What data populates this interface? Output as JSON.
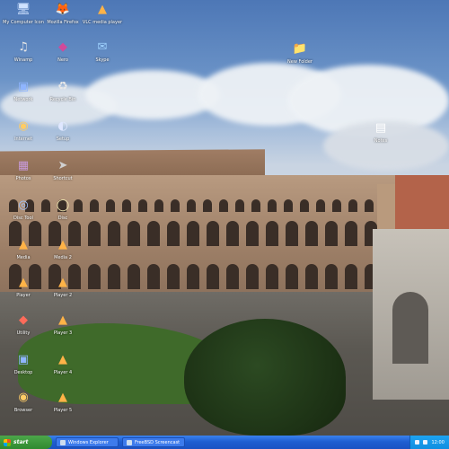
{
  "desktop": {
    "icons": [
      {
        "label": "My Computer Icon",
        "glyph": "🖥",
        "color": "#cfe2ff"
      },
      {
        "label": "Mozilla Firefox",
        "glyph": "🦊",
        "color": "#ffd9a0"
      },
      {
        "label": "VLC media player",
        "glyph": "▲",
        "color": "#ffb347"
      },
      {
        "label": "Winamp",
        "glyph": "♫",
        "color": "#e6e6e6"
      },
      {
        "label": "Nero",
        "glyph": "◆",
        "color": "#d04a9a"
      },
      {
        "label": "Skype",
        "glyph": "✉",
        "color": "#9fd3ff"
      },
      {
        "label": "New Folder",
        "glyph": "📁",
        "color": "#ffe37a"
      },
      {
        "label": "Network",
        "glyph": "▣",
        "color": "#8fb5ff"
      },
      {
        "label": "Recycle Bin",
        "glyph": "♻",
        "color": "#e8e8e8"
      },
      {
        "label": "Internet",
        "glyph": "◉",
        "color": "#ffcc66"
      },
      {
        "label": "Setup",
        "glyph": "◐",
        "color": "#dfe7ff"
      },
      {
        "label": "Notes",
        "glyph": "▤",
        "color": "#ffffff"
      },
      {
        "label": "Photos",
        "glyph": "▦",
        "color": "#c79ad9"
      },
      {
        "label": "Shortcut",
        "glyph": "➤",
        "color": "#d0d0d0"
      },
      {
        "label": "Disc Tool",
        "glyph": "◎",
        "color": "#a0c4ff"
      },
      {
        "label": "Disc",
        "glyph": "◯",
        "color": "#f0e6b0"
      },
      {
        "label": "Media",
        "glyph": "▲",
        "color": "#ffb347"
      },
      {
        "label": "Media 2",
        "glyph": "▲",
        "color": "#ffb347"
      },
      {
        "label": "Player",
        "glyph": "▲",
        "color": "#ffb347"
      },
      {
        "label": "Player 2",
        "glyph": "▲",
        "color": "#ffb347"
      },
      {
        "label": "Utility",
        "glyph": "◆",
        "color": "#ff6b5a"
      },
      {
        "label": "Player 3",
        "glyph": "▲",
        "color": "#ffb347"
      },
      {
        "label": "Desktop",
        "glyph": "▣",
        "color": "#8fb5ff"
      },
      {
        "label": "Player 4",
        "glyph": "▲",
        "color": "#ffb347"
      },
      {
        "label": "Browser",
        "glyph": "◉",
        "color": "#ffcc66"
      },
      {
        "label": "Player 5",
        "glyph": "▲",
        "color": "#ffb347"
      }
    ]
  },
  "taskbar": {
    "start_label": "start",
    "tasks": [
      {
        "label": "Windows Explorer"
      },
      {
        "label": "FreeBSD Screencast"
      }
    ],
    "clock": "12:00"
  }
}
